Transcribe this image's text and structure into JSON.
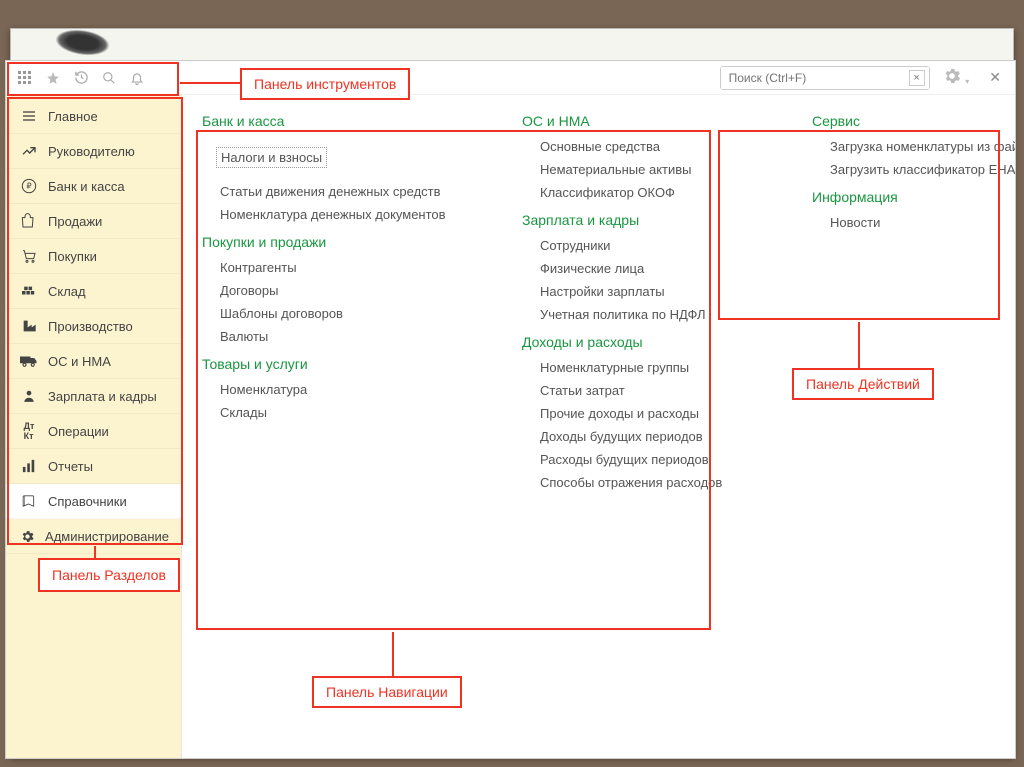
{
  "search": {
    "placeholder": "Поиск (Ctrl+F)"
  },
  "sidebar": {
    "items": [
      {
        "icon": "menu",
        "label": "Главное"
      },
      {
        "icon": "chart",
        "label": "Руководителю"
      },
      {
        "icon": "ruble",
        "label": "Банк и касса"
      },
      {
        "icon": "bag",
        "label": "Продажи"
      },
      {
        "icon": "cart",
        "label": "Покупки"
      },
      {
        "icon": "warehouse",
        "label": "Склад"
      },
      {
        "icon": "factory",
        "label": "Производство"
      },
      {
        "icon": "truck",
        "label": "ОС и НМА"
      },
      {
        "icon": "person",
        "label": "Зарплата и кадры"
      },
      {
        "icon": "ops",
        "label": "Операции"
      },
      {
        "icon": "bars",
        "label": "Отчеты"
      },
      {
        "icon": "book",
        "label": "Справочники"
      },
      {
        "icon": "gear",
        "label": "Администрирование"
      }
    ]
  },
  "nav": {
    "col1": [
      {
        "title": "Банк и касса",
        "items": [
          {
            "label": "Налоги и взносы",
            "dotted": true
          },
          {
            "label": "Статьи движения денежных средств"
          },
          {
            "label": "Номенклатура денежных документов"
          }
        ]
      },
      {
        "title": "Покупки и продажи",
        "items": [
          {
            "label": "Контрагенты"
          },
          {
            "label": "Договоры"
          },
          {
            "label": "Шаблоны договоров"
          },
          {
            "label": "Валюты"
          }
        ]
      },
      {
        "title": "Товары и услуги",
        "items": [
          {
            "label": "Номенклатура"
          },
          {
            "label": "Склады"
          }
        ]
      }
    ],
    "col2": [
      {
        "title": "ОС и НМА",
        "items": [
          {
            "label": "Основные средства"
          },
          {
            "label": "Нематериальные активы"
          },
          {
            "label": "Классификатор ОКОФ"
          }
        ]
      },
      {
        "title": "Зарплата и кадры",
        "items": [
          {
            "label": "Сотрудники"
          },
          {
            "label": "Физические лица"
          },
          {
            "label": "Настройки зарплаты"
          },
          {
            "label": "Учетная политика по НДФЛ"
          }
        ]
      },
      {
        "title": "Доходы и расходы",
        "items": [
          {
            "label": "Номенклатурные группы"
          },
          {
            "label": "Статьи затрат"
          },
          {
            "label": "Прочие доходы и расходы"
          },
          {
            "label": "Доходы будущих периодов"
          },
          {
            "label": "Расходы будущих периодов"
          },
          {
            "label": "Способы отражения расходов"
          }
        ]
      }
    ],
    "col3": [
      {
        "title": "Сервис",
        "items": [
          {
            "label": "Загрузка номенклатуры из файла"
          },
          {
            "label": "Загрузить классификатор ЕНАОФ"
          }
        ]
      },
      {
        "title": "Информация",
        "items": [
          {
            "label": "Новости"
          }
        ]
      }
    ]
  },
  "callouts": {
    "toolbar": "Панель инструментов",
    "sections": "Панель Разделов",
    "navigation": "Панель Навигации",
    "actions": "Панель Действий"
  }
}
